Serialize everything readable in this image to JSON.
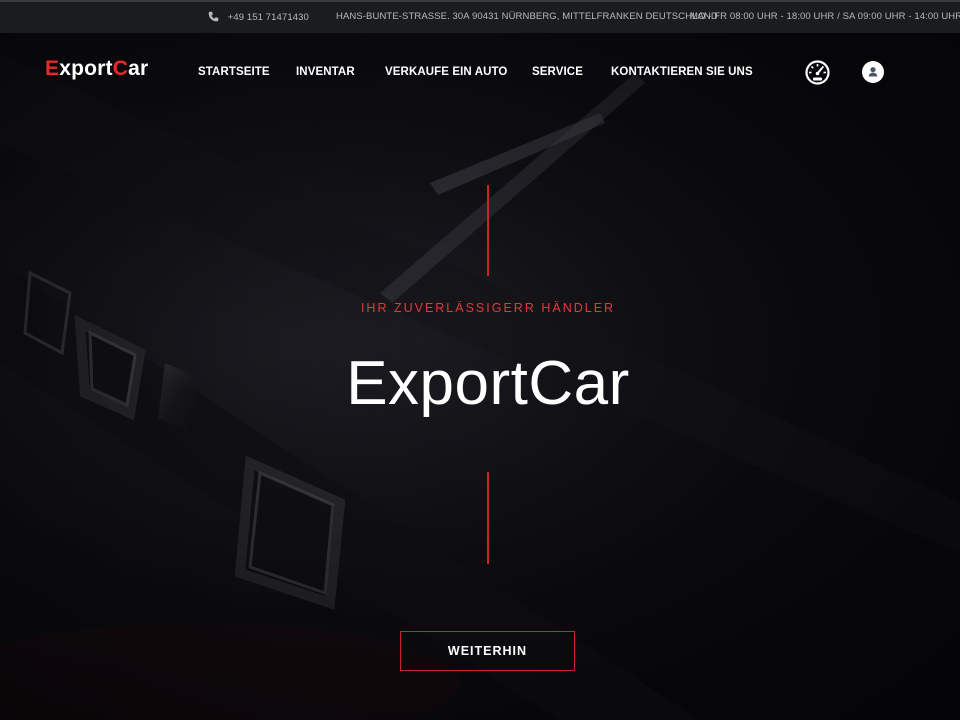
{
  "topbar": {
    "phone": "+49 151 71471430",
    "address": "HANS-BUNTE-STRASSE. 30A 90431 NÜRNBERG, MITTELFRANKEN DEUTSCHLAND",
    "hours": "MO - FR 08:00 UHR - 18:00 UHR / SA 09:00 UHR - 14:00 UHR"
  },
  "logo": {
    "part1": "E",
    "part2": "xport",
    "part3": "C",
    "part4": "ar"
  },
  "nav": {
    "items": [
      {
        "label": "STARTSEITE"
      },
      {
        "label": "INVENTAR"
      },
      {
        "label": "VERKAUFE EIN AUTO"
      },
      {
        "label": "SERVICE"
      },
      {
        "label": "KONTAKTIEREN SIE UNS"
      }
    ],
    "icons": [
      "speedometer-icon",
      "user-icon"
    ]
  },
  "hero": {
    "tagline": "IHR ZUVERLÄSSIGERR HÄNDLER",
    "title": "ExportCar",
    "button": "WEITERHIN"
  },
  "colors": {
    "accent": "#e52a2a",
    "line": "#c8252b",
    "topbar_bg": "#1b1c1f",
    "hero_bg": "#0d0d11"
  }
}
